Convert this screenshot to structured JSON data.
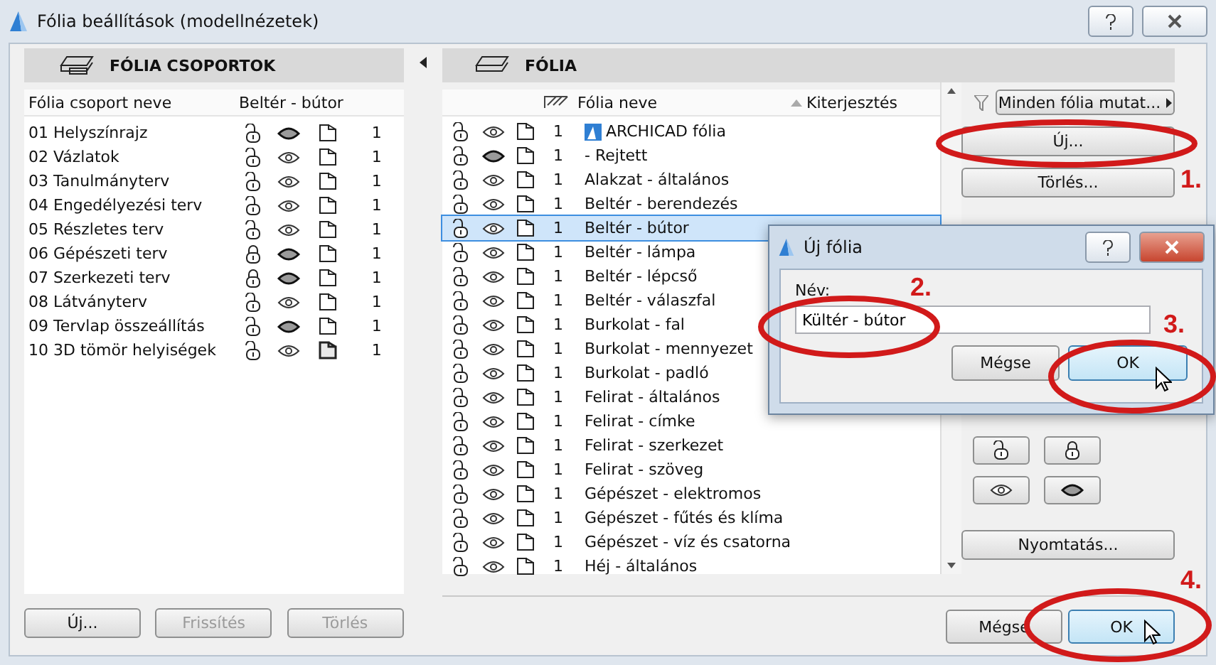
{
  "window": {
    "title": "Fólia beállítások (modellnézetek)"
  },
  "groups_panel": {
    "title": "FÓLIA CSOPORTOK",
    "columns": [
      "Fólia csoport neve",
      "Beltér - bútor"
    ],
    "rows": [
      {
        "name": "01 Helyszínrajz",
        "locked": false,
        "visible": false,
        "solid": false,
        "number": "1"
      },
      {
        "name": "02 Vázlatok",
        "locked": false,
        "visible": true,
        "solid": false,
        "number": "1"
      },
      {
        "name": "03 Tanulmányterv",
        "locked": false,
        "visible": true,
        "solid": false,
        "number": "1"
      },
      {
        "name": "04 Engedélyezési terv",
        "locked": false,
        "visible": true,
        "solid": false,
        "number": "1"
      },
      {
        "name": "05 Részletes terv",
        "locked": false,
        "visible": true,
        "solid": false,
        "number": "1"
      },
      {
        "name": "06 Gépészeti terv",
        "locked": true,
        "visible": false,
        "solid": false,
        "number": "1"
      },
      {
        "name": "07 Szerkezeti terv",
        "locked": true,
        "visible": false,
        "solid": false,
        "number": "1"
      },
      {
        "name": "08 Látványterv",
        "locked": false,
        "visible": true,
        "solid": false,
        "number": "1"
      },
      {
        "name": "09 Tervlap összeállítás",
        "locked": false,
        "visible": false,
        "solid": false,
        "number": "1"
      },
      {
        "name": "10 3D tömör helyiségek",
        "locked": false,
        "visible": true,
        "solid": true,
        "number": "1"
      }
    ],
    "buttons": [
      {
        "label": "Új...",
        "disabled": false
      },
      {
        "label": "Frissítés",
        "disabled": true
      },
      {
        "label": "Törlés",
        "disabled": true
      }
    ]
  },
  "layers_panel": {
    "title": "FÓLIA",
    "columns": [
      "Fólia neve",
      "Kiterjesztés"
    ],
    "rows": [
      {
        "kind": "system",
        "name": "ARCHICAD fólia",
        "locked": false,
        "visible": true,
        "number": "1",
        "selected": false
      },
      {
        "kind": "layer",
        "name": "- Rejtett",
        "locked": false,
        "visible": false,
        "number": "1",
        "selected": false
      },
      {
        "kind": "layer",
        "name": "Alakzat - általános",
        "locked": false,
        "visible": true,
        "number": "1",
        "selected": false
      },
      {
        "kind": "layer",
        "name": "Beltér - berendezés",
        "locked": false,
        "visible": true,
        "number": "1",
        "selected": false
      },
      {
        "kind": "layer",
        "name": "Beltér - bútor",
        "locked": false,
        "visible": true,
        "number": "1",
        "selected": true
      },
      {
        "kind": "layer",
        "name": "Beltér - lámpa",
        "locked": false,
        "visible": true,
        "number": "1",
        "selected": false
      },
      {
        "kind": "layer",
        "name": "Beltér - lépcső",
        "locked": false,
        "visible": true,
        "number": "1",
        "selected": false
      },
      {
        "kind": "layer",
        "name": "Beltér - válaszfal",
        "locked": false,
        "visible": true,
        "number": "1",
        "selected": false
      },
      {
        "kind": "layer",
        "name": "Burkolat - fal",
        "locked": false,
        "visible": true,
        "number": "1",
        "selected": false
      },
      {
        "kind": "layer",
        "name": "Burkolat - mennyezet",
        "locked": false,
        "visible": true,
        "number": "1",
        "selected": false
      },
      {
        "kind": "layer",
        "name": "Burkolat - padló",
        "locked": false,
        "visible": true,
        "number": "1",
        "selected": false
      },
      {
        "kind": "layer",
        "name": "Felirat - általános",
        "locked": false,
        "visible": true,
        "number": "1",
        "selected": false
      },
      {
        "kind": "layer",
        "name": "Felirat - címke",
        "locked": false,
        "visible": true,
        "number": "1",
        "selected": false
      },
      {
        "kind": "layer",
        "name": "Felirat - szerkezet",
        "locked": false,
        "visible": true,
        "number": "1",
        "selected": false
      },
      {
        "kind": "layer",
        "name": "Felirat - szöveg",
        "locked": false,
        "visible": true,
        "number": "1",
        "selected": false
      },
      {
        "kind": "layer",
        "name": "Gépészet - elektromos",
        "locked": false,
        "visible": true,
        "number": "1",
        "selected": false
      },
      {
        "kind": "layer",
        "name": "Gépészet - fűtés és klíma",
        "locked": false,
        "visible": true,
        "number": "1",
        "selected": false
      },
      {
        "kind": "layer",
        "name": "Gépészet - víz és csatorna",
        "locked": false,
        "visible": true,
        "number": "1",
        "selected": false
      },
      {
        "kind": "layer",
        "name": "Héj - általános",
        "locked": false,
        "visible": true,
        "number": "1",
        "selected": false
      }
    ],
    "filter_button": "Minden fólia mutat...",
    "top_buttons": [
      "Új...",
      "Törlés..."
    ],
    "print_button": "Nyomtatás..."
  },
  "footer": {
    "buttons": [
      {
        "label": "Mégse",
        "default": false
      },
      {
        "label": "OK",
        "default": true
      }
    ]
  },
  "dialog": {
    "title": "Új fólia",
    "field_label": "Név:",
    "value": "Kültér - bútor",
    "buttons": [
      {
        "label": "Mégse",
        "default": false
      },
      {
        "label": "OK",
        "default": true
      }
    ]
  },
  "annotations": [
    {
      "text": "1."
    },
    {
      "text": "2."
    },
    {
      "text": "3."
    },
    {
      "text": "4."
    }
  ]
}
